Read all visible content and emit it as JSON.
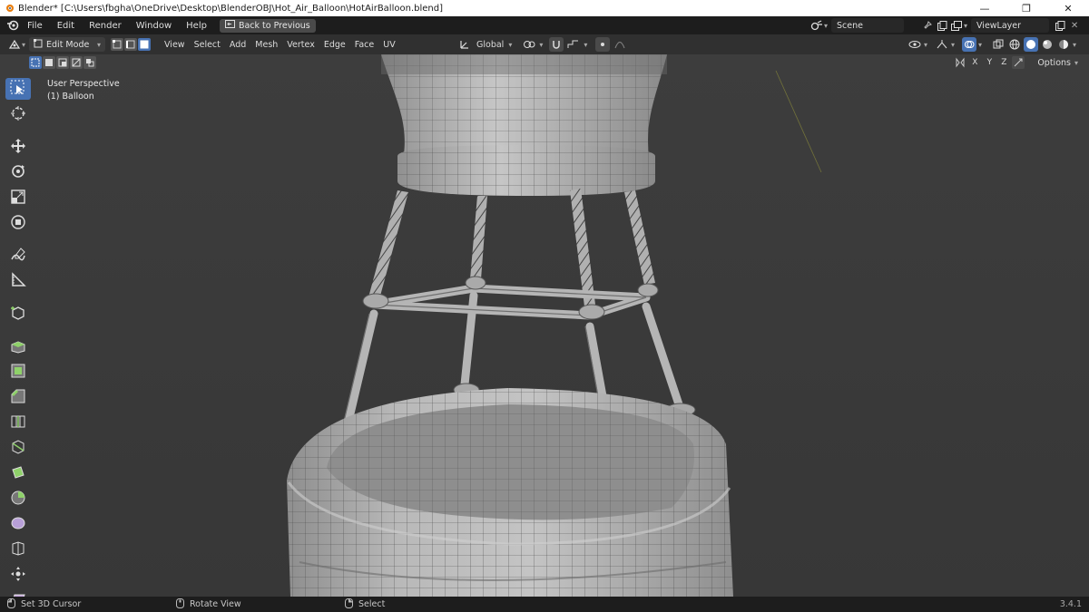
{
  "window": {
    "title": "Blender* [C:\\Users\\fbgha\\OneDrive\\Desktop\\BlenderOBJ\\Hot_Air_Balloon\\HotAirBalloon.blend]",
    "minimize": "—",
    "maximize": "❐",
    "close": "✕"
  },
  "topbar": {
    "menus": [
      "File",
      "Edit",
      "Render",
      "Window",
      "Help"
    ],
    "back_button": "Back to Previous",
    "scene": "Scene",
    "view_layer": "ViewLayer"
  },
  "header": {
    "mode": "Edit Mode",
    "menus": [
      "View",
      "Select",
      "Add",
      "Mesh",
      "Vertex",
      "Edge",
      "Face",
      "UV"
    ],
    "orientation": "Global",
    "options_label": "Options",
    "axes": [
      "X",
      "Y",
      "Z"
    ]
  },
  "viewport": {
    "perspective_label": "User Perspective",
    "object_label": "(1) Balloon"
  },
  "statusbar": {
    "items": [
      "Set 3D Cursor",
      "Rotate View",
      "Select"
    ],
    "version": "3.4.1"
  },
  "colors": {
    "accent": "#4772b3",
    "viewport_bg": "#3b3b3b",
    "mesh": "#b4b4b4"
  }
}
